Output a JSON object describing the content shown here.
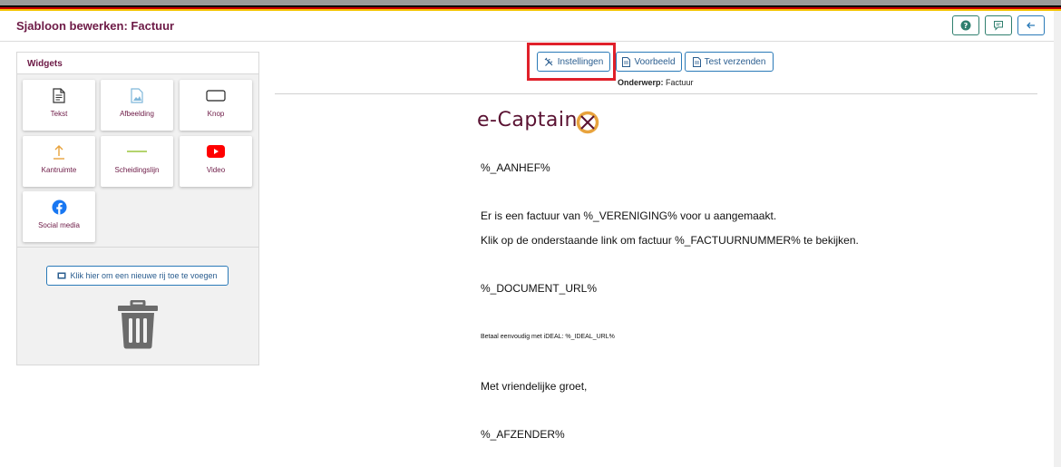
{
  "page": {
    "title": "Sjabloon bewerken: Factuur",
    "header_icons": [
      "help-icon",
      "comment-icon",
      "arrow-left-icon"
    ],
    "brand_color": "#6d1a46",
    "accent_color": "#2a7ab8"
  },
  "widgets": {
    "title": "Widgets",
    "items": [
      {
        "label": "Tekst",
        "icon": "document-icon"
      },
      {
        "label": "Afbeelding",
        "icon": "image-icon"
      },
      {
        "label": "Knop",
        "icon": "button-icon"
      },
      {
        "label": "Kantruimte",
        "icon": "upload-arrow-icon"
      },
      {
        "label": "Scheidingslijn",
        "icon": "divider-line-icon"
      },
      {
        "label": "Video",
        "icon": "youtube-icon"
      },
      {
        "label": "Social media",
        "icon": "facebook-icon"
      }
    ],
    "add_row_label": "Klik hier om een nieuwe rij toe te voegen",
    "trash_icon": "trash-icon"
  },
  "toolbar": {
    "settings_label": "Instellingen",
    "preview_label": "Voorbeeld",
    "test_label": "Test verzenden"
  },
  "email": {
    "subject_label": "Onderwerp:",
    "subject_value": "Factuur",
    "logo_text": "e-Captain",
    "lines": {
      "aanhef": "%_AANHEF%",
      "line1": "Er is een factuur van %_VERENIGING% voor u aangemaakt.",
      "line2": "Klik op de onderstaande link om factuur %_FACTUURNUMMER% te bekijken.",
      "doc_url": "%_DOCUMENT_URL%",
      "ideal": "Betaal eenvoudig met iDEAL: %_IDEAL_URL%",
      "groet": "Met vriendelijke groet,",
      "afzender": "%_AFZENDER%"
    }
  }
}
